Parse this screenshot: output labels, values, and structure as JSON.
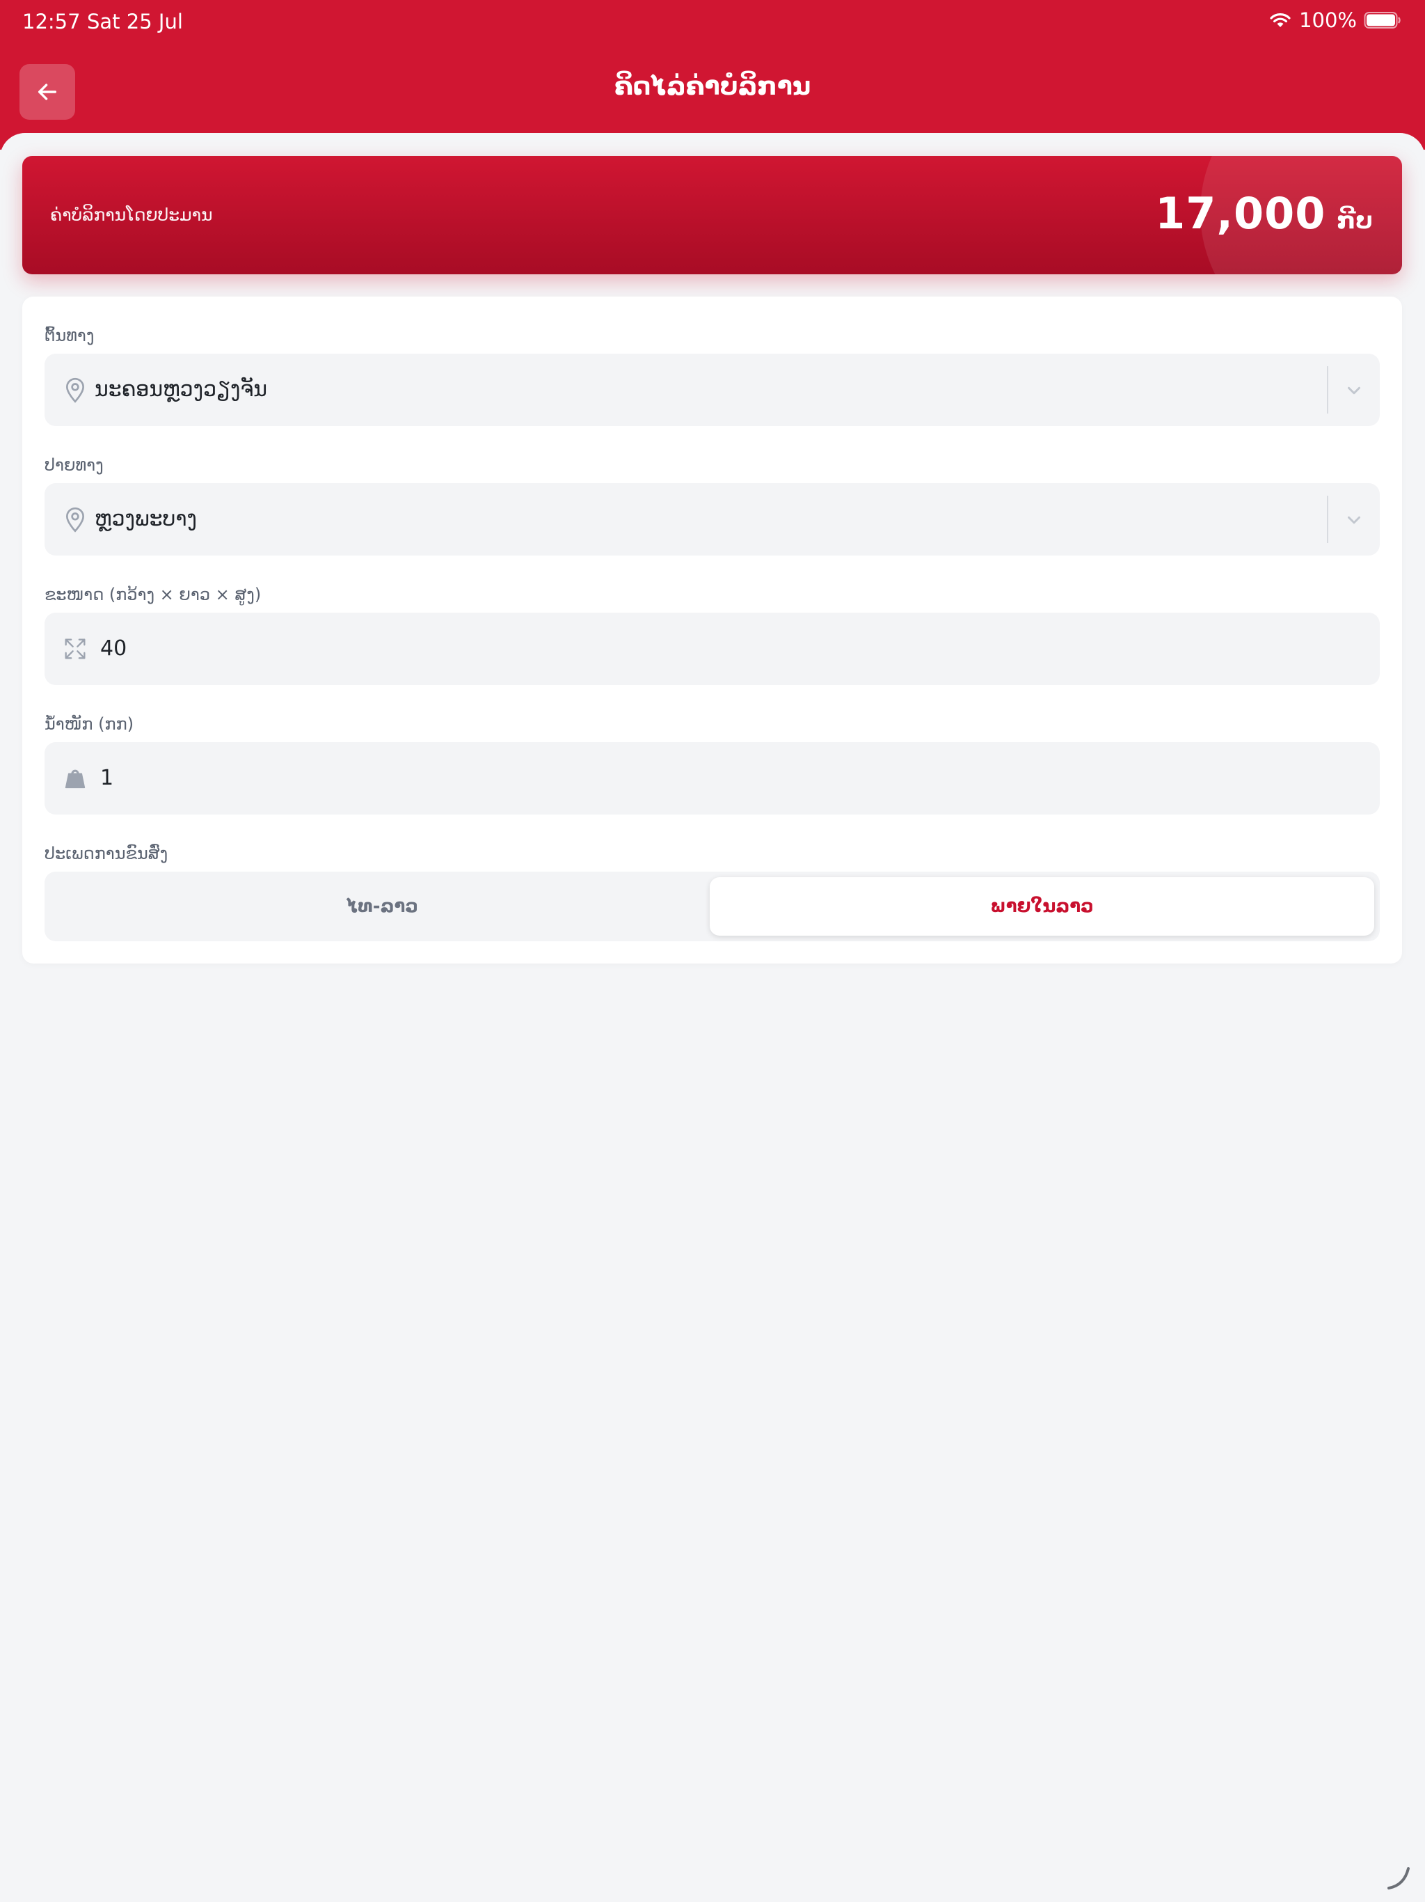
{
  "status_bar": {
    "time": "12:57",
    "date": "Sat 25 Jul",
    "battery": "100%"
  },
  "header": {
    "title": "ຄິດໄລ່ຄ່າບໍລິການ",
    "back_icon": "arrow-left-icon",
    "background_color": "#d01632"
  },
  "estimate": {
    "label": "ຄ່າບໍລິການໂດຍປະມານ",
    "amount": "17,000",
    "unit": "ກີບ"
  },
  "form": {
    "origin": {
      "label": "ຕົ້ນທາງ",
      "value": "ນະຄອນຫຼວງວຽງຈັນ",
      "icon": "map-pin-icon"
    },
    "destination": {
      "label": "ປາຍທາງ",
      "value": "ຫຼວງພະບາງ",
      "icon": "map-pin-icon"
    },
    "dimensions": {
      "label": "ຂະໜາດ (ກວ້າງ × ຍາວ × ສູງ)",
      "value": "40",
      "icon": "expand-icon"
    },
    "weight": {
      "label": "ນ້ຳໜັກ (ກກ)",
      "value": "1",
      "icon": "weight-icon"
    },
    "shipping_type": {
      "label": "ປະເພດການຂົນສົ່ງ",
      "options": [
        "ໄທ-ລາວ",
        "ພາຍໃນລາວ"
      ],
      "selected": "ພາຍໃນລາວ"
    }
  },
  "colors": {
    "accent": "#d01632",
    "selected_text": "#c8102e",
    "background": "#f4f5f7"
  }
}
